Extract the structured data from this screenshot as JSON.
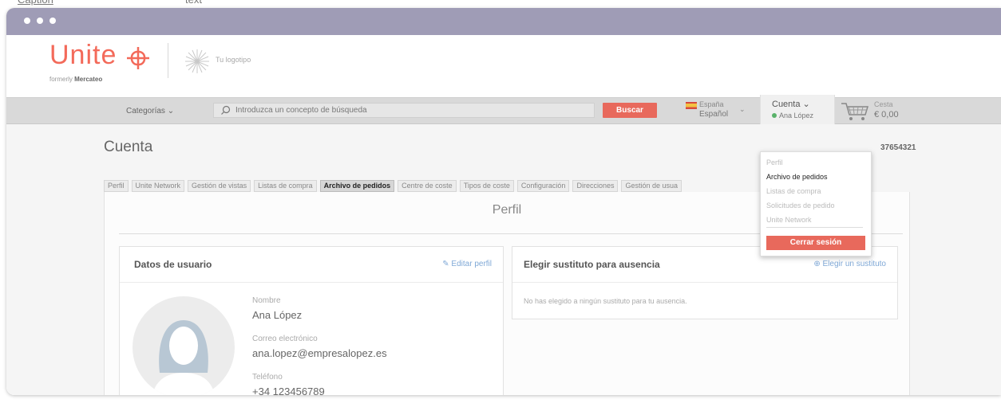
{
  "window": {
    "dot_color": "#ffffff",
    "titlebar_color": "#9f9cb6"
  },
  "brand": {
    "name": "Unite",
    "formerly_prefix": "formerly",
    "formerly_name": "Mercateo",
    "customer_logo_text": "Tu logotipo",
    "accent_color": "#f36a5a"
  },
  "navbar": {
    "categories_label": "Categorías",
    "search_placeholder": "Introduzca un concepto de búsqueda",
    "search_button": "Buscar",
    "country": "España",
    "language": "Español",
    "account_label": "Cuenta",
    "user_name": "Ana López",
    "cart_label": "Cesta",
    "cart_amount": "€ 0,00",
    "icons": [
      "chevron-down-icon",
      "search-icon",
      "spain-flag-icon",
      "online-status-icon",
      "cart-icon"
    ]
  },
  "account_menu": {
    "items": [
      "Perfil",
      "Archivo de pedidos",
      "Listas de compra",
      "Solicitudes de pedido",
      "Unite Network"
    ],
    "highlighted": "Archivo de pedidos",
    "logout": "Cerrar sesión"
  },
  "page": {
    "title": "Cuenta",
    "account_number": "37654321",
    "tabs": [
      "Perfil",
      "Unite Network",
      "Gestión de vistas",
      "Listas de compra",
      "Archivo de pedidos",
      "Centre de coste",
      "Tipos de coste",
      "Configuración",
      "Direcciones",
      "Gestión de usua"
    ],
    "active_tab": "Archivo de pedidos",
    "section_title": "Perfil"
  },
  "user_card": {
    "title": "Datos de usuario",
    "edit_label": "Editar perfil",
    "name_label": "Nombre",
    "name_value": "Ana López",
    "email_label": "Correo electrónico",
    "email_value": "ana.lopez@empresalopez.es",
    "phone_label": "Teléfono",
    "phone_value": "+34 123456789"
  },
  "substitute_card": {
    "title": "Elegir sustituto para ausencia",
    "action_label": "Elegir un sustituto",
    "empty_message": "No has elegido a ningún sustituto para tu ausencia."
  }
}
